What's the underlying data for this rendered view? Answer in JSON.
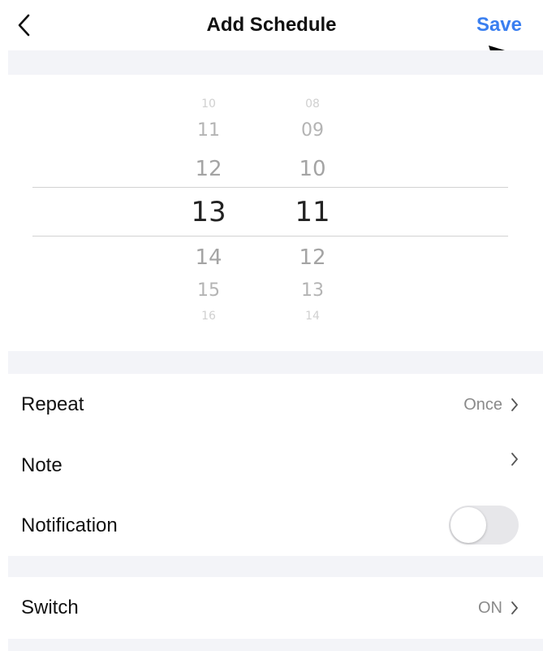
{
  "header": {
    "back_icon": "chevron-left-icon",
    "title": "Add Schedule",
    "save_label": "Save"
  },
  "picker": {
    "hours": [
      "10",
      "11",
      "12",
      "13",
      "14",
      "15",
      "16"
    ],
    "minutes": [
      "08",
      "09",
      "10",
      "11",
      "12",
      "13",
      "14"
    ],
    "selected_hour": "13",
    "selected_minute": "11"
  },
  "settings": {
    "repeat": {
      "label": "Repeat",
      "value": "Once"
    },
    "note": {
      "label": "Note",
      "value": ""
    },
    "notification": {
      "label": "Notification",
      "enabled": false
    },
    "switch": {
      "label": "Switch",
      "value": "ON"
    }
  },
  "colors": {
    "accent": "#3a7ff0",
    "separator": "#f3f4f8",
    "toggle_off": "#e7e7ea"
  }
}
